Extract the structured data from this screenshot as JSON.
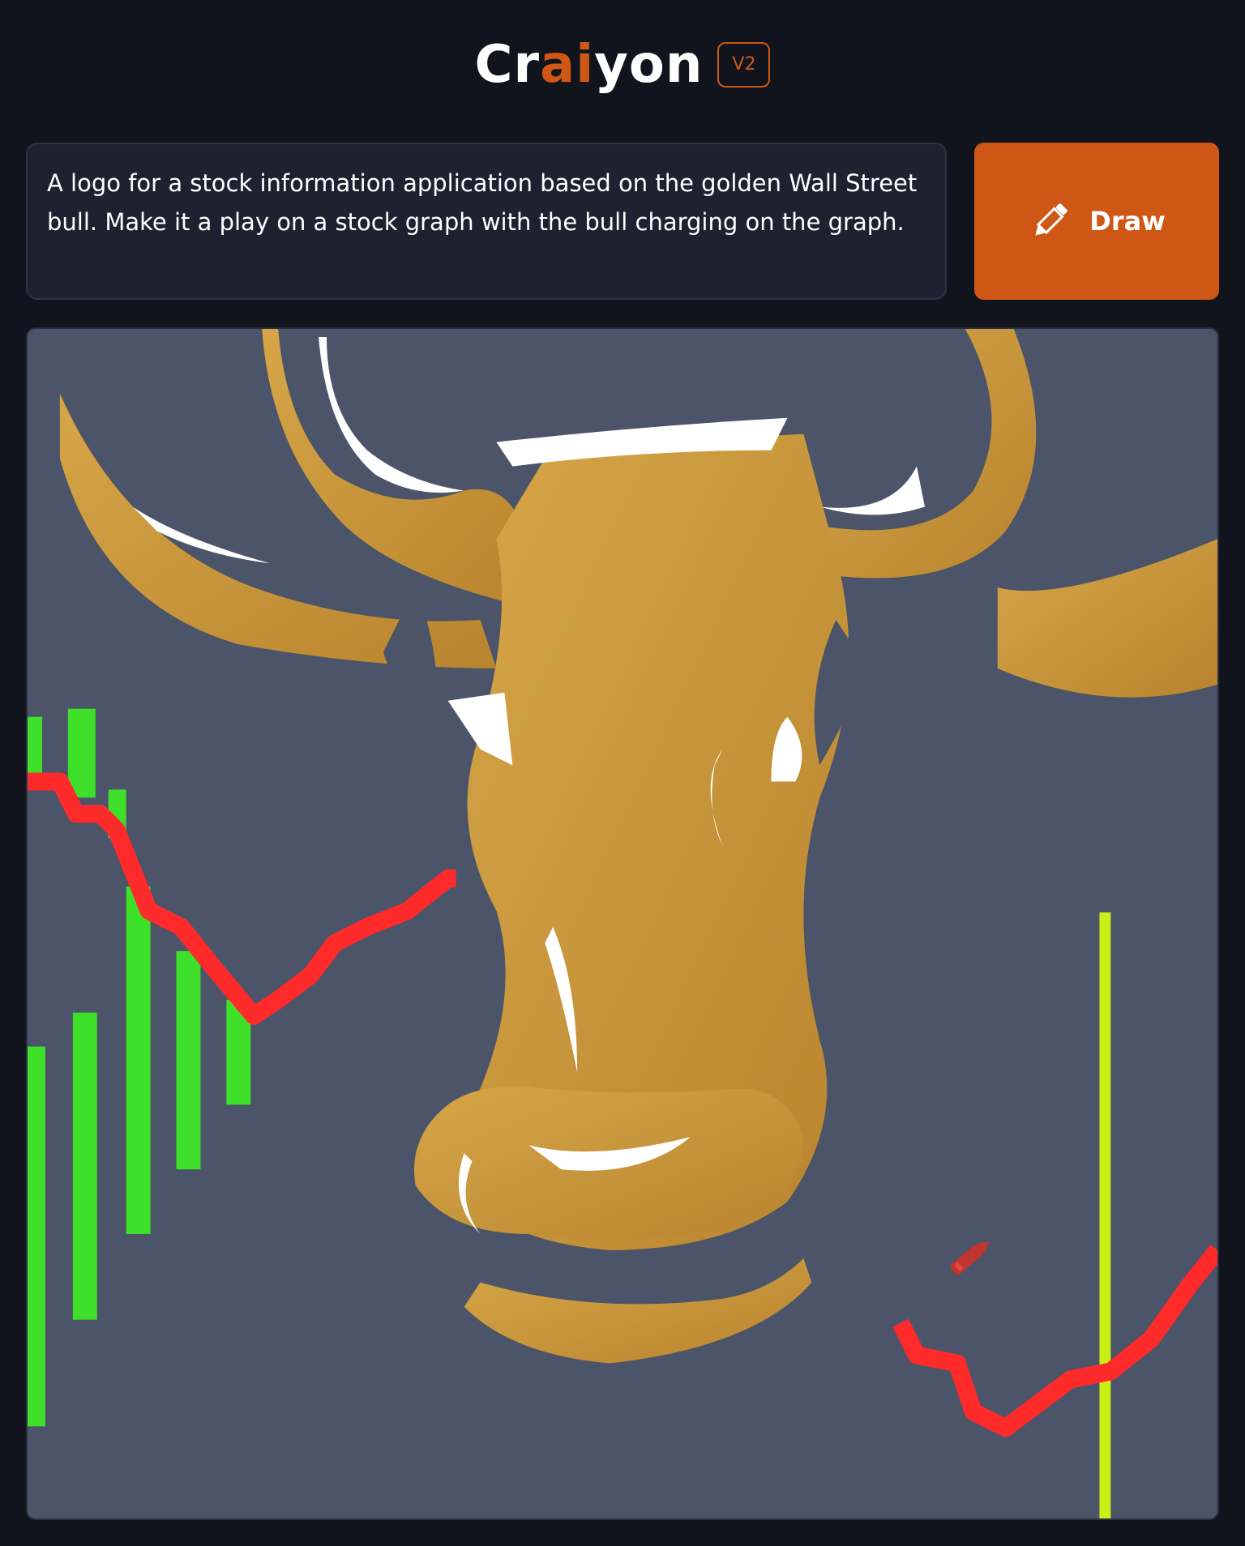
{
  "app": {
    "logo_parts": [
      "Cr",
      "ai",
      "yon"
    ],
    "version": "V2"
  },
  "prompt": {
    "text": "A logo for a stock information application based on the golden Wall Street bull. Make it a play on a stock graph with the bull charging on the graph."
  },
  "draw_button": {
    "label": "Draw",
    "icon": "pencil-icon"
  },
  "colors": {
    "background": "#11141c",
    "accent": "#cf5716",
    "prompt_bg": "#1e2230",
    "image_bg": "#4a5568",
    "gold": "#c8953a",
    "candle_green": "#3fe02a",
    "line_red": "#ff2a2a"
  },
  "image": {
    "subject": "golden-bull-stock-graph",
    "watermark_icon": "crayon-icon"
  }
}
